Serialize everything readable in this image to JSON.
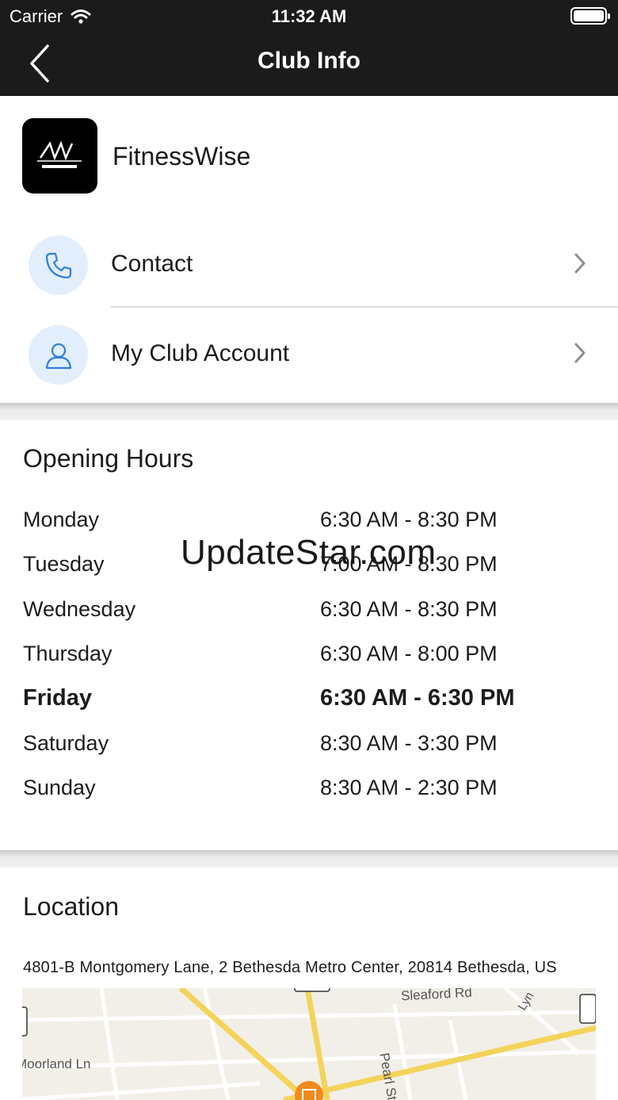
{
  "status_bar": {
    "carrier": "Carrier",
    "time": "11:32 AM"
  },
  "nav": {
    "title": "Club Info"
  },
  "club": {
    "name": "FitnessWise"
  },
  "menu": [
    {
      "label": "Contact",
      "icon": "phone-icon"
    },
    {
      "label": "My Club Account",
      "icon": "user-icon"
    }
  ],
  "hours": {
    "title": "Opening Hours",
    "rows": [
      {
        "day": "Monday",
        "hours": "6:30 AM - 8:30 PM"
      },
      {
        "day": "Tuesday",
        "hours": "7:00 AM - 8:30 PM"
      },
      {
        "day": "Wednesday",
        "hours": "6:30 AM - 8:30 PM"
      },
      {
        "day": "Thursday",
        "hours": "6:30 AM - 8:00 PM"
      },
      {
        "day": "Friday",
        "hours": "6:30 AM - 6:30 PM"
      },
      {
        "day": "Saturday",
        "hours": "8:30 AM - 3:30 PM"
      },
      {
        "day": "Sunday",
        "hours": "8:30 AM - 2:30 PM"
      }
    ]
  },
  "location": {
    "title": "Location",
    "address": "4801-B  Montgomery Lane, 2 Bethesda Metro Center, 20814 Bethesda, US",
    "map_labels": {
      "street1": "Sleaford Rd",
      "street2": "Pearl St",
      "street3": "Moorland Ln",
      "street4": "Lyn"
    }
  },
  "watermark": "UpdateStar.com",
  "colors": {
    "nav_bg": "#1b1b1b",
    "icon_bg": "#e3eefc",
    "icon_stroke": "#2f7fe0",
    "map_pin": "#f08a1c"
  }
}
